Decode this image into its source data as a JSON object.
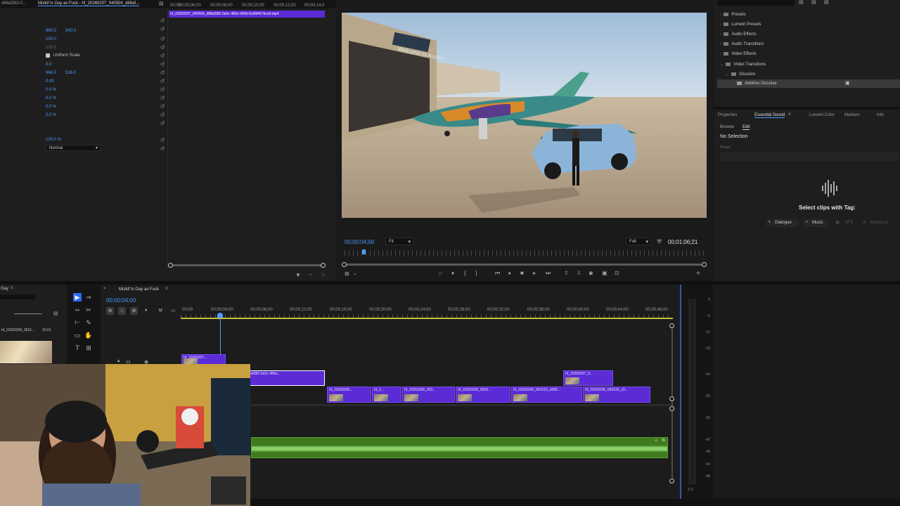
{
  "effect_controls": {
    "tabs": [
      "d88af382-0...",
      "Mizkif Is Gay as Fuck - hf_20260207_040504_d88af..."
    ],
    "clip_name": "hf_20260207_040504_d88af382-0e5c-486e-940b-5c96f4576ce9.mp4",
    "position_x": "960.0",
    "position_y": "540.0",
    "scale": "100.0",
    "scale_width": "100.0",
    "uniform_scale_label": "Uniform Scale",
    "rotation": "0.0",
    "anchor_x": "964.0",
    "anchor_y": "538.0",
    "anti_flicker": "0.00",
    "crop_left": "0.0 %",
    "crop_top": "0.0 %",
    "crop_right": "0.0 %",
    "crop_bottom": "0.0 %",
    "opacity": "100.0 %",
    "blend_mode": "Normal",
    "ruler_ticks": [
      "00;00",
      "00;00;06;00",
      "00;00;08;00",
      "00;00;10;00",
      "00;00;12;00",
      "00;00;14;0"
    ]
  },
  "program_monitor": {
    "timecode": "00;00;04;00",
    "fit": "Fit",
    "quality": "Full",
    "duration": "00;01;06;21",
    "sign_text": "Welcome to Austin"
  },
  "effects_panel": {
    "items": [
      {
        "label": "Presets",
        "level": 0
      },
      {
        "label": "Lumetri Presets",
        "level": 0
      },
      {
        "label": "Audio Effects",
        "level": 0
      },
      {
        "label": "Audio Transitions",
        "level": 0
      },
      {
        "label": "Video Effects",
        "level": 0
      },
      {
        "label": "Video Transitions",
        "level": 0
      },
      {
        "label": "Dissolve",
        "level": 1
      },
      {
        "label": "Additive Dissolve",
        "level": 2
      }
    ]
  },
  "essential_sound": {
    "tabs": [
      "Properties",
      "Essential Sound",
      "Lumetri Color",
      "Markers",
      "Info"
    ],
    "subtabs": [
      "Browse",
      "Edit"
    ],
    "selection": "No Selection",
    "preset_label": "Preset:",
    "select_text": "Select clips with Tag:",
    "tags": [
      "Dialogue",
      "Music",
      "SFX",
      "Ambience"
    ]
  },
  "project_panel": {
    "title": "Gay",
    "file_name": "hf_20260206_0621...",
    "file_duration": "10;01"
  },
  "timeline": {
    "sequence_name": "Mizkif Is Gay as Fuck",
    "timecode": "00;00;04;00",
    "ticks": [
      "00;00",
      "00;00;04;00",
      "00;00;08;00",
      "00;00;12;00",
      "00;00;16;00",
      "00;00;20;00",
      "00;00;24;00",
      "00;00;28;00",
      "00;00;32;00",
      "00;00;36;00",
      "00;00;40;00",
      "00;00;44;00",
      "00;00;48;00"
    ],
    "track_label": "V3",
    "clips": {
      "v3_a": "hf_20260207...",
      "v2_main": "_040504_d88af382-0e5c-486e...",
      "v2_b": "hf_20260207_0...",
      "v1_1": "hf_20260206...",
      "v1_2": "hf_2...",
      "v1_3": "hf_20260206_053...",
      "v1_4": "hf_20260206_0559...",
      "v1_5": "hf_20260206_061615_e868...",
      "v1_6": "hf_20260206_062535_c0..."
    }
  },
  "meter": {
    "labels": [
      "0",
      "-6",
      "-12",
      "-18",
      "-24",
      "-30",
      "-36",
      "-42",
      "-48",
      "-54",
      "-dB"
    ],
    "bottom": "S S"
  }
}
